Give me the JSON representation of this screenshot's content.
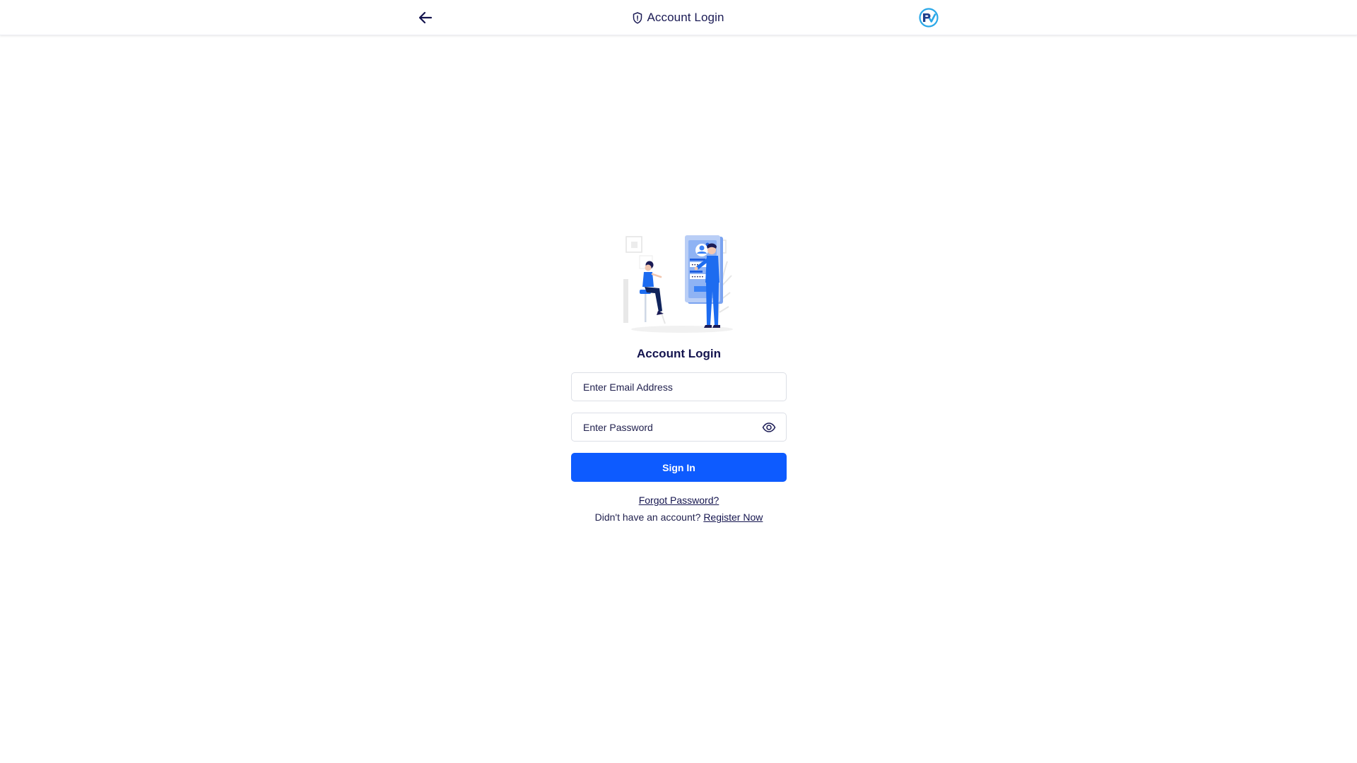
{
  "header": {
    "back_icon": "arrow-left-icon",
    "title_icon": "shield-icon",
    "title": "Account Login",
    "logo_icon": "brand-logo"
  },
  "login": {
    "illustration": "login-illustration",
    "title": "Account Login",
    "email": {
      "placeholder": "Enter Email Address",
      "value": ""
    },
    "password": {
      "placeholder": "Enter Password",
      "value": "",
      "toggle_icon": "eye-icon"
    },
    "signin_label": "Sign In",
    "forgot_label": "Forgot Password?",
    "register_prompt": "Didn't have an account?",
    "register_label": "Register Now"
  },
  "colors": {
    "primary": "#0d5bff",
    "text_dark": "#14144e",
    "border": "#dcdfe6",
    "background": "#ffffff"
  }
}
